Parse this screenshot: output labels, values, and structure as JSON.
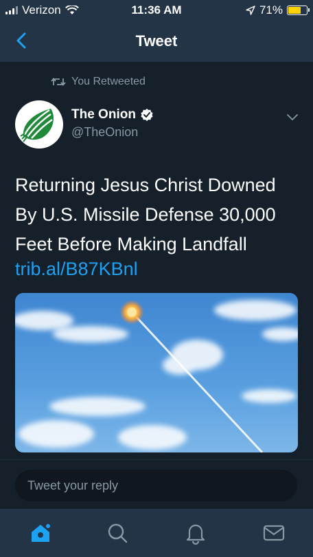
{
  "status_bar": {
    "carrier": "Verizon",
    "time": "11:36 AM",
    "battery_percent": "71%",
    "battery_level": 0.71,
    "battery_color": "#ffd400"
  },
  "nav": {
    "title": "Tweet",
    "back_icon": "chevron-left-icon"
  },
  "tweet": {
    "retweet_context": "You Retweeted",
    "author_name": "The Onion",
    "author_handle": "@TheOnion",
    "verified": true,
    "text": "Returning Jesus Christ Downed By U.S. Missile Defense 30,000 Feet Before Making Landfall",
    "link": "trib.al/B87KBnl",
    "media": "sky-missile-image"
  },
  "reply": {
    "placeholder": "Tweet your reply"
  },
  "tab_bar": {
    "items": [
      "home-icon",
      "search-icon",
      "notifications-icon",
      "messages-icon"
    ],
    "active": "home-icon"
  },
  "colors": {
    "background": "#15202b",
    "bar": "#243447",
    "accent": "#1da1f2",
    "secondary_text": "#8899a6"
  }
}
